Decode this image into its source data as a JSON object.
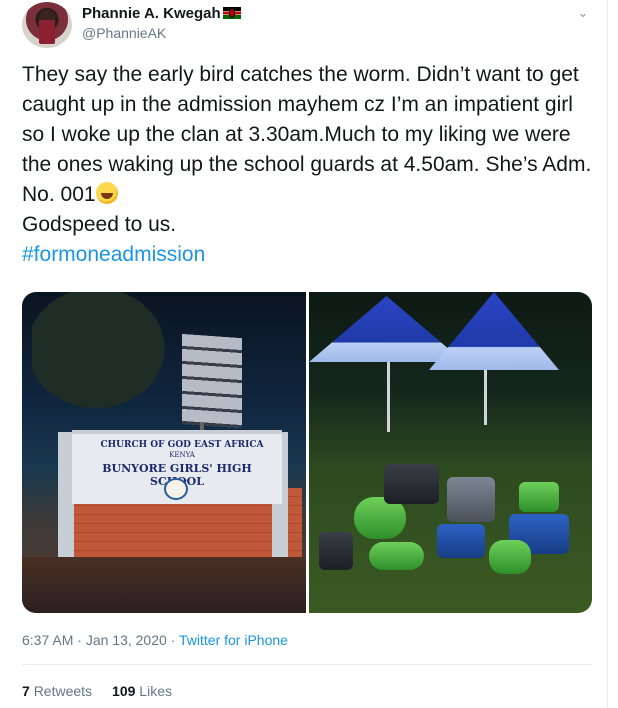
{
  "user": {
    "display_name": "Phannie A. Kwegah",
    "handle": "@PhannieAK",
    "flag_icon": "kenya-flag-icon"
  },
  "tweet": {
    "text": "They say the early bird catches the worm. Didn’t want to get caught up in the admission mayhem cz I’m an impatient girl so I woke up the clan at 3.30am.Much to my liking we were the ones waking up the school guards at 4.50am. She’s Adm. No. 001",
    "emoji": "rolling-on-floor-laughing-emoji",
    "text_after": "Godspeed to us.",
    "hashtag": "#formoneadmission"
  },
  "photos": {
    "left": {
      "sign_line1": "CHURCH OF GOD EAST AFRICA",
      "sign_line2": "KENYA",
      "sign_line3": "BUNYORE GIRLS' HIGH SCHOOL"
    }
  },
  "meta": {
    "time": "6:37 AM",
    "separator": " · ",
    "date": "Jan 13, 2020",
    "source": "Twitter for iPhone"
  },
  "stats": {
    "retweets_count": "7",
    "retweets_label": "Retweets",
    "likes_count": "109",
    "likes_label": "Likes"
  },
  "colors": {
    "link": "#1b95e0",
    "secondary_text": "#657786",
    "primary_text": "#14171a"
  }
}
